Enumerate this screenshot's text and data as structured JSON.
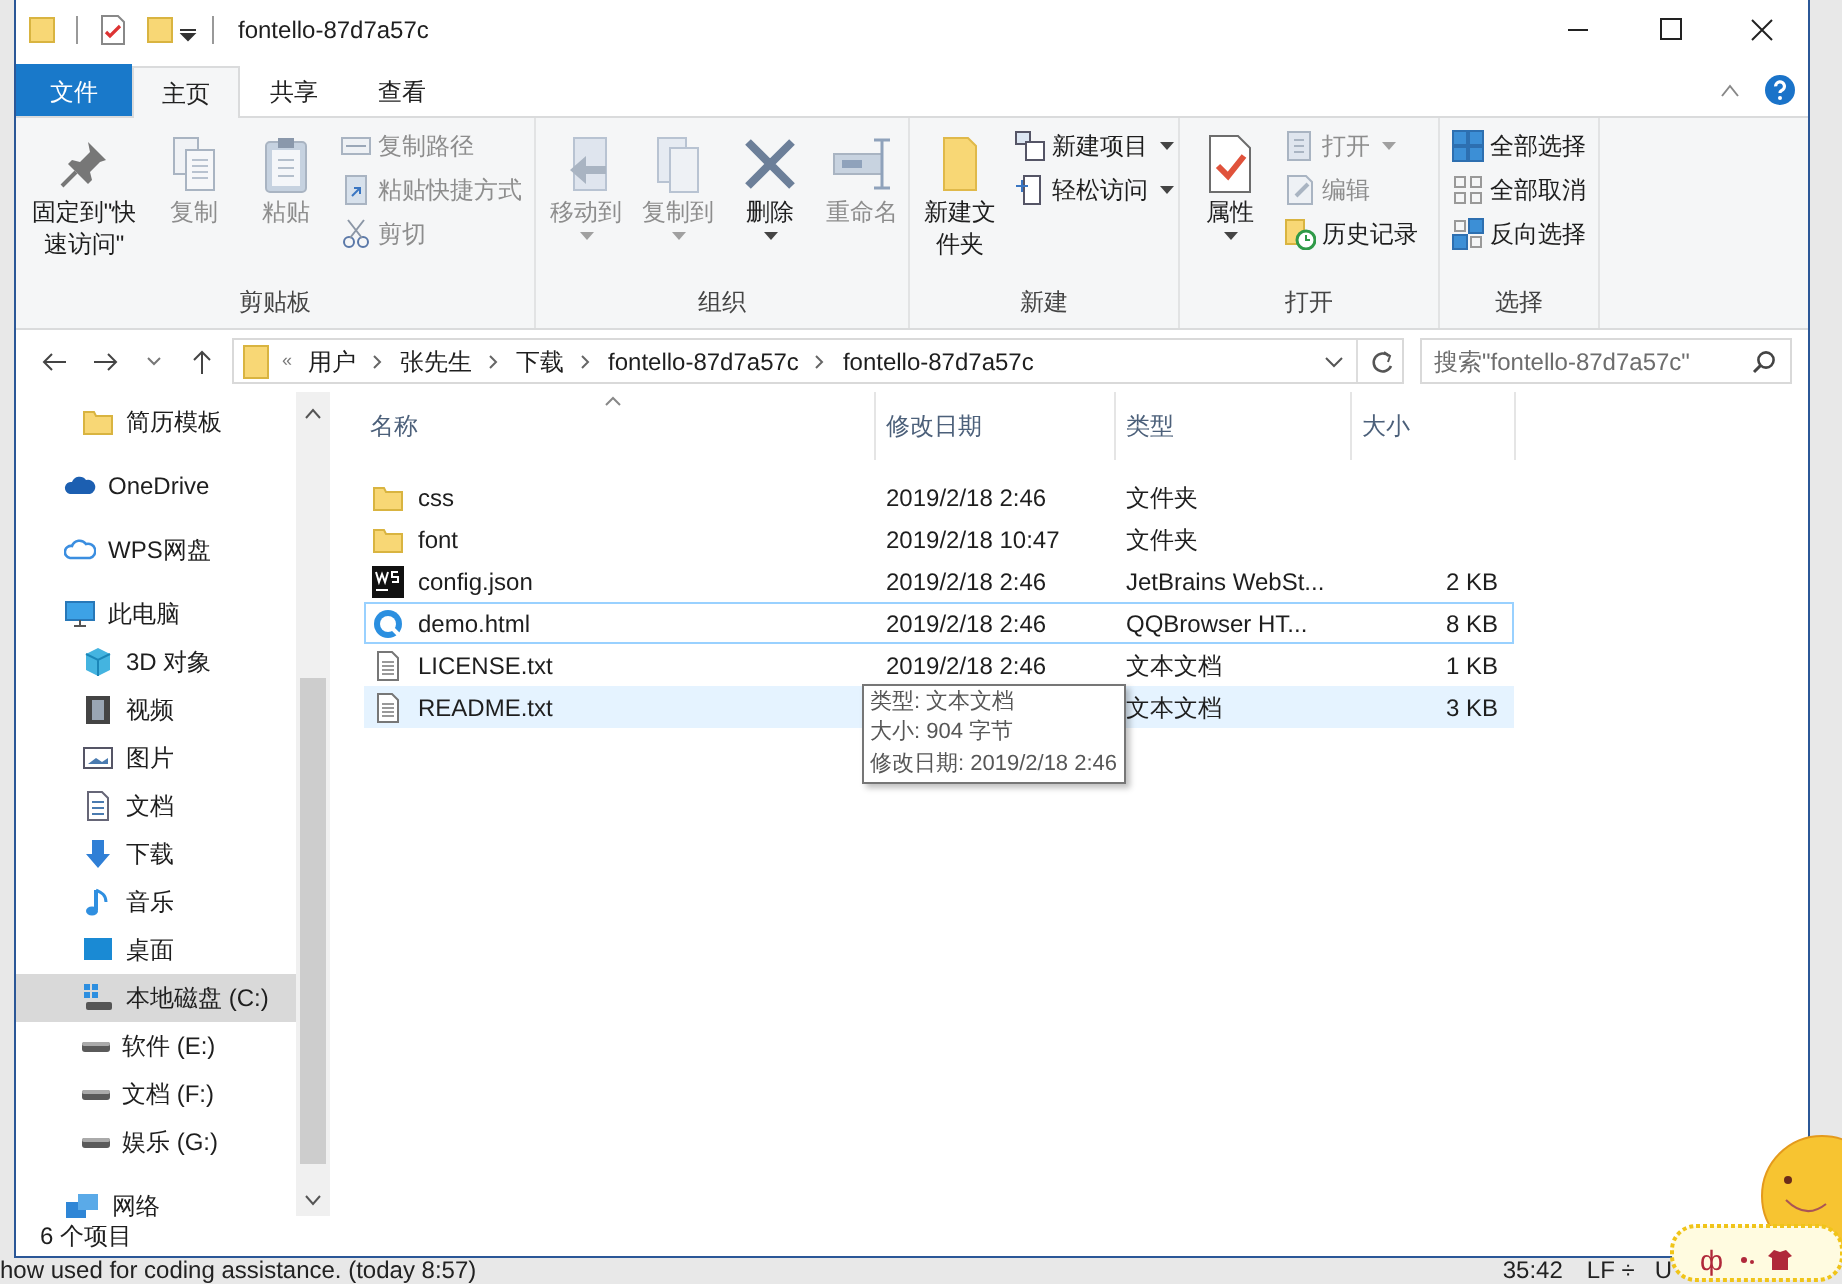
{
  "title_bar": {
    "title": "fontello-87d7a57c"
  },
  "ribbon_tabs": [
    {
      "label": "文件",
      "kind": "file",
      "selected": false
    },
    {
      "label": "主页",
      "kind": "tab",
      "selected": true
    },
    {
      "label": "共享",
      "kind": "tab",
      "selected": false
    },
    {
      "label": "查看",
      "kind": "tab",
      "selected": false
    }
  ],
  "ribbon_groups": [
    {
      "label": "剪贴板",
      "items": [
        {
          "label": "固定到\"快速访问\"",
          "kind": "large",
          "disabled": false,
          "dropdown": false
        },
        {
          "label": "复制",
          "kind": "large",
          "disabled": true,
          "dropdown": false
        },
        {
          "label": "粘贴",
          "kind": "large",
          "disabled": true,
          "dropdown": false
        },
        {
          "label": "复制路径",
          "kind": "small",
          "disabled": true,
          "dropdown": false
        },
        {
          "label": "粘贴快捷方式",
          "kind": "small",
          "disabled": true,
          "dropdown": false
        },
        {
          "label": "剪切",
          "kind": "small",
          "disabled": true,
          "dropdown": false
        }
      ]
    },
    {
      "label": "组织",
      "items": [
        {
          "label": "移动到",
          "kind": "large",
          "disabled": true,
          "dropdown": true
        },
        {
          "label": "复制到",
          "kind": "large",
          "disabled": true,
          "dropdown": true
        },
        {
          "label": "删除",
          "kind": "large",
          "disabled": false,
          "dropdown": true
        },
        {
          "label": "重命名",
          "kind": "large",
          "disabled": true,
          "dropdown": false
        }
      ]
    },
    {
      "label": "新建",
      "items": [
        {
          "label": "新建文件夹",
          "kind": "large",
          "disabled": false,
          "dropdown": false
        },
        {
          "label": "新建项目",
          "kind": "small",
          "disabled": false,
          "dropdown": true
        },
        {
          "label": "轻松访问",
          "kind": "small",
          "disabled": false,
          "dropdown": true
        }
      ]
    },
    {
      "label": "打开",
      "items": [
        {
          "label": "属性",
          "kind": "large",
          "disabled": false,
          "dropdown": true
        },
        {
          "label": "打开",
          "kind": "small",
          "disabled": true,
          "dropdown": true
        },
        {
          "label": "编辑",
          "kind": "small",
          "disabled": true,
          "dropdown": false
        },
        {
          "label": "历史记录",
          "kind": "small",
          "disabled": false,
          "dropdown": false
        }
      ]
    },
    {
      "label": "选择",
      "items": [
        {
          "label": "全部选择",
          "kind": "small",
          "disabled": false,
          "dropdown": false
        },
        {
          "label": "全部取消",
          "kind": "small",
          "disabled": false,
          "dropdown": false
        },
        {
          "label": "反向选择",
          "kind": "small",
          "disabled": false,
          "dropdown": false
        }
      ]
    }
  ],
  "address_bar": {
    "overflow": "«",
    "path": [
      "用户",
      "张先生",
      "下载",
      "fontello-87d7a57c",
      "fontello-87d7a57c"
    ]
  },
  "search": {
    "placeholder": "搜索\"fontello-87d7a57c\""
  },
  "nav": [
    {
      "children": [
        {
          "label": "简历模板",
          "kind": "folder",
          "selected": false
        }
      ]
    },
    {
      "label": "OneDrive",
      "kind": "onedrive",
      "selected": false
    },
    {
      "label": "WPS网盘",
      "kind": "cloud",
      "selected": false
    },
    {
      "label": "此电脑",
      "kind": "pc",
      "selected": false,
      "children": [
        {
          "label": "3D 对象",
          "kind": "cube",
          "selected": false
        },
        {
          "label": "视频",
          "kind": "video",
          "selected": false
        },
        {
          "label": "图片",
          "kind": "picture",
          "selected": false
        },
        {
          "label": "文档",
          "kind": "document",
          "selected": false
        },
        {
          "label": "下载",
          "kind": "download",
          "selected": false
        },
        {
          "label": "音乐",
          "kind": "music",
          "selected": false
        },
        {
          "label": "桌面",
          "kind": "desktop",
          "selected": false
        },
        {
          "label": "本地磁盘 (C:)",
          "kind": "system-drive",
          "selected": true
        },
        {
          "label": "软件 (E:)",
          "kind": "drive",
          "selected": false
        },
        {
          "label": "文档 (F:)",
          "kind": "drive",
          "selected": false
        },
        {
          "label": "娱乐 (G:)",
          "kind": "drive",
          "selected": false
        }
      ]
    },
    {
      "label": "网络",
      "kind": "network",
      "selected": false
    }
  ],
  "table": {
    "columns": [
      {
        "label": "名称",
        "sorted": true
      },
      {
        "label": "修改日期",
        "sorted": false
      },
      {
        "label": "类型",
        "sorted": false
      },
      {
        "label": "大小",
        "sorted": false
      }
    ],
    "rows": [
      {
        "kind": "folder",
        "name": "css",
        "date": "2019/2/18 2:46",
        "type": "文件夹",
        "focused": false,
        "hovered": false
      },
      {
        "kind": "folder",
        "name": "font",
        "date": "2019/2/18 10:47",
        "type": "文件夹",
        "focused": false,
        "hovered": false
      },
      {
        "kind": "webstorm",
        "name": "config.json",
        "date": "2019/2/18 2:46",
        "type": "JetBrains WebSt...",
        "size": "2 KB",
        "focused": false,
        "hovered": false
      },
      {
        "kind": "browser",
        "name": "demo.html",
        "date": "2019/2/18 2:46",
        "type": "QQBrowser HT...",
        "size": "8 KB",
        "focused": true,
        "hovered": false
      },
      {
        "kind": "text",
        "name": "LICENSE.txt",
        "date": "2019/2/18 2:46",
        "type": "文本文档",
        "size": "1 KB",
        "focused": false,
        "hovered": false
      },
      {
        "kind": "text",
        "name": "README.txt",
        "type": "文本文档",
        "size": "3 KB",
        "focused": false,
        "hovered": true
      }
    ]
  },
  "tooltip": [
    "类型: 文本文档",
    "大小: 904 字节",
    "修改日期: 2019/2/18 2:46"
  ],
  "status_bar": {
    "count": "6 个项目"
  },
  "background_app": {
    "message": "how used for coding assistance. (today 8:57)",
    "position": "35:42",
    "line_ending": "LF ÷",
    "encoding": "U"
  },
  "ime_bar": {
    "symbol": "ф"
  }
}
